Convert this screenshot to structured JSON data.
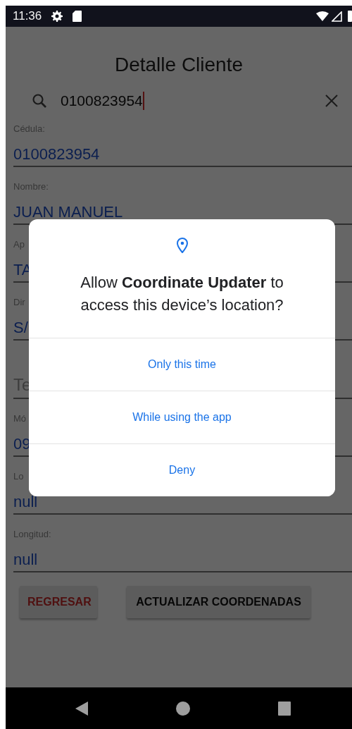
{
  "status_bar": {
    "time": "11:36"
  },
  "title": "Detalle Cliente",
  "search": {
    "value": "0100823954"
  },
  "fields": [
    {
      "kind": "labeled",
      "label": "Cédula:",
      "value": "0100823954"
    },
    {
      "kind": "labeled",
      "label": "Nombre:",
      "value": "JUAN MANUEL"
    },
    {
      "kind": "labeled",
      "label": "Ap",
      "value": "TA"
    },
    {
      "kind": "labeled",
      "label": "Dir",
      "value": "S/"
    },
    {
      "kind": "hint",
      "placeholder": "Te"
    },
    {
      "kind": "labeled",
      "label": "Mó",
      "value": "09"
    },
    {
      "kind": "labeled",
      "label": "Lo",
      "value": "null"
    },
    {
      "kind": "labeled",
      "label": "Longitud:",
      "value": "null"
    }
  ],
  "buttons": [
    {
      "kind": "back",
      "label": "REGRESAR"
    },
    {
      "kind": "primary",
      "label": "ACTUALIZAR COORDENADAS"
    }
  ],
  "dialog": {
    "title": "Allow **Coordinate Updater** to access this device’s location?",
    "options": [
      "Only this time",
      "While using the app",
      "Deny"
    ]
  }
}
